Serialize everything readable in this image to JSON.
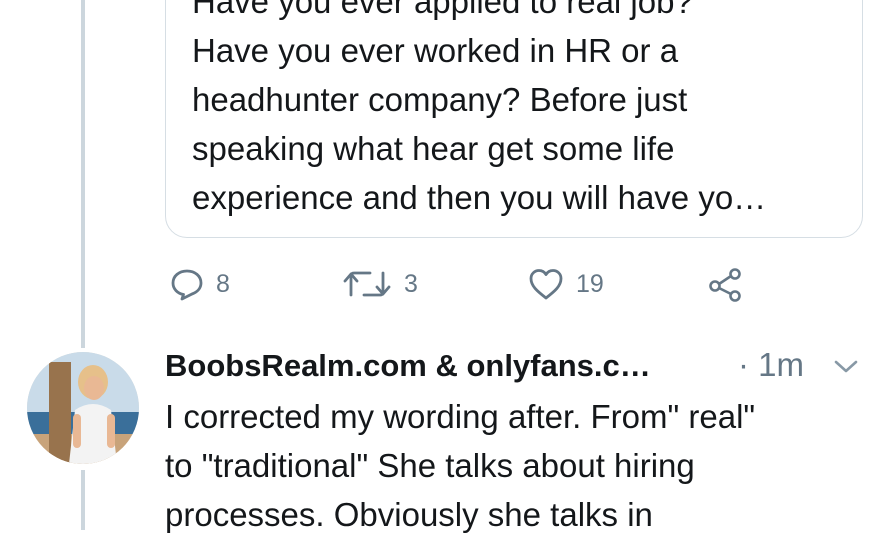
{
  "quoted_tweet": {
    "lines": [
      "Have you ever applied to real job?",
      "Have you ever worked in HR or a",
      "headhunter company? Before just",
      "speaking what hear get some life",
      "experience and then you will have yo…"
    ]
  },
  "actions": {
    "reply_count": "8",
    "retweet_count": "3",
    "like_count": "19"
  },
  "reply_tweet": {
    "author_name": "BoobsRealm.com & onlyfans.c…",
    "time": "· 1m",
    "lines": [
      "I corrected my wording after. From\" real\"",
      "to \"traditional\" She talks about hiring",
      "processes. Obviously she talks in"
    ]
  },
  "colors": {
    "text": "#14171a",
    "secondary": "#657786",
    "border": "#d6dee4",
    "thread_line": "#ccd6dd"
  },
  "icons": [
    "reply-icon",
    "retweet-icon",
    "like-icon",
    "share-icon",
    "chevron-down-icon"
  ]
}
